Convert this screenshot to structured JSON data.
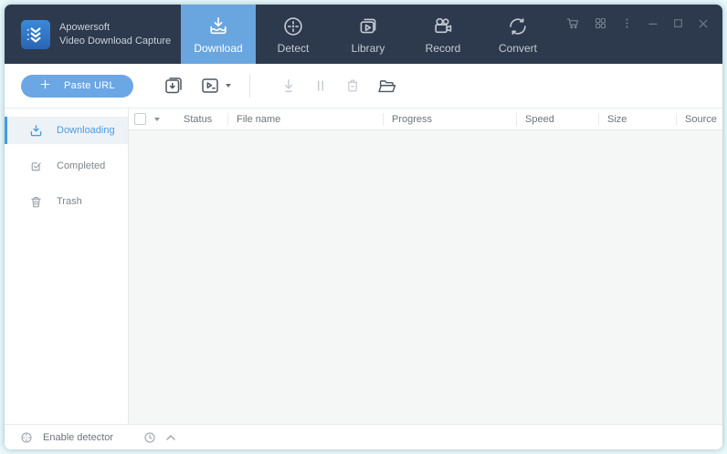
{
  "app": {
    "name_line1": "Apowersoft",
    "name_line2": "Video Download Capture"
  },
  "nav": {
    "tabs": [
      {
        "label": "Download",
        "active": true
      },
      {
        "label": "Detect",
        "active": false
      },
      {
        "label": "Library",
        "active": false
      },
      {
        "label": "Record",
        "active": false
      },
      {
        "label": "Convert",
        "active": false
      }
    ]
  },
  "window_controls": {
    "icons": [
      "cart-icon",
      "apps-grid-icon",
      "more-menu-icon",
      "minimize-icon",
      "maximize-icon",
      "close-icon"
    ]
  },
  "toolbar": {
    "paste_url_label": "Paste URL",
    "icons": [
      "batch-download-icon",
      "video-format-icon",
      "start-download-icon",
      "pause-icon",
      "delete-icon",
      "open-folder-icon"
    ]
  },
  "sidebar": {
    "items": [
      {
        "label": "Downloading",
        "active": true
      },
      {
        "label": "Completed",
        "active": false
      },
      {
        "label": "Trash",
        "active": false
      }
    ]
  },
  "table": {
    "columns": [
      "Status",
      "File name",
      "Progress",
      "Speed",
      "Size",
      "Source"
    ],
    "rows": []
  },
  "statusbar": {
    "enable_detector_label": "Enable detector",
    "icons": [
      "detector-target-icon",
      "schedule-clock-icon",
      "expand-caret-icon"
    ]
  },
  "colors": {
    "header_bg": "#2d3a4e",
    "active_tab_bg": "#69a6df",
    "accent_blue": "#4a9ce0",
    "paste_button_bg": "#6ba6e5",
    "content_bg": "#f5f6f6"
  }
}
